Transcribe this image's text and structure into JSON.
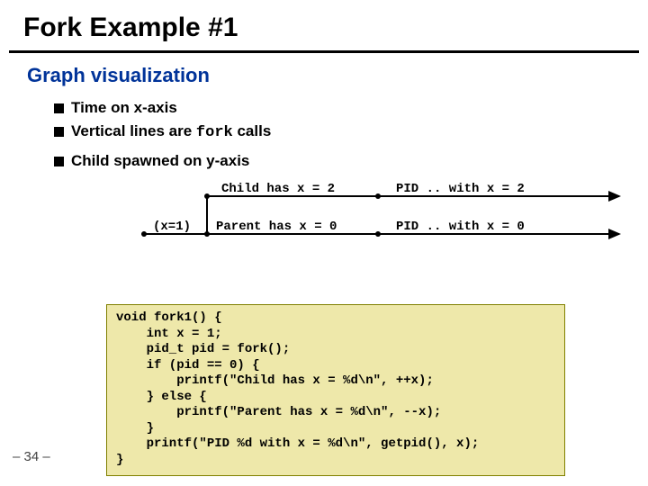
{
  "title": "Fork Example #1",
  "subtitle": "Graph visualization",
  "bullets": {
    "b1_pre": "Time on x-axis",
    "b2_pre": "Vertical lines are ",
    "b2_mono": "fork",
    "b2_post": " calls",
    "b3": "Child spawned on y-axis"
  },
  "graph": {
    "init": "(x=1)",
    "child_l": "Child has x = 2",
    "child_r": "PID .. with x = 2",
    "parent_l": "Parent has x = 0",
    "parent_r": "PID .. with x = 0"
  },
  "code": "void fork1() {\n    int x = 1;\n    pid_t pid = fork();\n    if (pid == 0) {\n        printf(\"Child has x = %d\\n\", ++x);\n    } else {\n        printf(\"Parent has x = %d\\n\", --x);\n    }\n    printf(\"PID %d with x = %d\\n\", getpid(), x);\n}",
  "pagenum": "– 34 –"
}
